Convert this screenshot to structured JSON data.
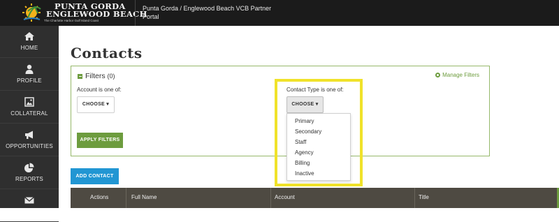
{
  "brand": {
    "logo_line1": "Punta Gorda",
    "logo_line2": "Englewood Beach",
    "logo_tagline": "The Charlotte Harbor Gulf Island Coast",
    "portal_title": "Punta Gorda / Englewood Beach VCB Partner Portal"
  },
  "sidebar": {
    "items": [
      {
        "label": "HOME",
        "icon": "home-icon"
      },
      {
        "label": "PROFILE",
        "icon": "user-icon"
      },
      {
        "label": "COLLATERAL",
        "icon": "image-icon"
      },
      {
        "label": "OPPORTUNITIES",
        "icon": "megaphone-icon"
      },
      {
        "label": "REPORTS",
        "icon": "pie-chart-icon"
      },
      {
        "label": "",
        "icon": "envelope-icon"
      }
    ]
  },
  "page": {
    "title": "Contacts"
  },
  "filters": {
    "title": "Filters",
    "count": "(0)",
    "manage_label": "Manage Filters",
    "account_label": "Account is one of:",
    "account_choose": "CHOOSE",
    "contact_type_label": "Contact Type is one of:",
    "contact_type_choose": "CHOOSE",
    "apply_label": "APPLY FILTERS"
  },
  "contact_type_options": [
    "Primary",
    "Secondary",
    "Staff",
    "Agency",
    "Billing",
    "Inactive"
  ],
  "add_contact_label": "ADD CONTACT",
  "table": {
    "headers": [
      "Actions",
      "Full Name",
      "Account",
      "Title"
    ]
  },
  "colors": {
    "topbar": "#1b1b1b",
    "sidebar": "#2f2f2f",
    "accent_green": "#6d9c3e",
    "accent_blue": "#2196d3",
    "highlight": "#f0e22a",
    "table_header": "#4e4a42"
  }
}
